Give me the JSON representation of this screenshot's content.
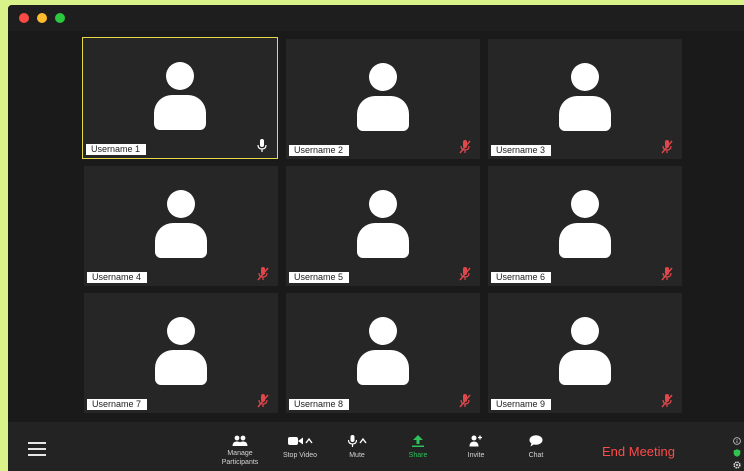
{
  "participants": [
    {
      "name": "Username 1",
      "mic": "on",
      "active": true
    },
    {
      "name": "Username 2",
      "mic": "muted",
      "active": false
    },
    {
      "name": "Username 3",
      "mic": "muted",
      "active": false
    },
    {
      "name": "Username 4",
      "mic": "muted",
      "active": false
    },
    {
      "name": "Username 5",
      "mic": "muted",
      "active": false
    },
    {
      "name": "Username 6",
      "mic": "muted",
      "active": false
    },
    {
      "name": "Username 7",
      "mic": "muted",
      "active": false
    },
    {
      "name": "Username 8",
      "mic": "muted",
      "active": false
    },
    {
      "name": "Username 9",
      "mic": "muted",
      "active": false
    }
  ],
  "toolbar": {
    "manage_participants": "Manage\nParticipants",
    "stop_video": "Stop Video",
    "mute": "Mute",
    "share": "Share",
    "invite": "Invite",
    "chat": "Chat",
    "end_meeting": "End Meeting"
  },
  "colors": {
    "active_border": "#e7d84b",
    "muted_mic": "#e0474c",
    "share_green": "#2dc25b",
    "end_red": "#ff4a4a"
  },
  "icons": {
    "mic_on": "microphone-icon",
    "mic_muted": "microphone-muted-icon"
  }
}
